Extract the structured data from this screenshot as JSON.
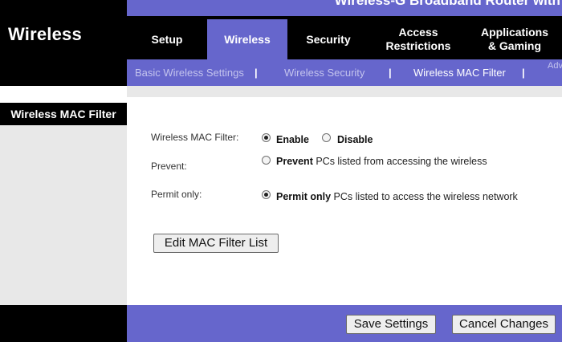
{
  "header": {
    "product_name": "Wireless-G Broadband Router with S",
    "section_title": "Wireless"
  },
  "main_nav": {
    "tabs": [
      {
        "label": "Setup"
      },
      {
        "label": "Wireless",
        "active": true
      },
      {
        "label": "Security"
      },
      {
        "label": "Access\nRestrictions"
      },
      {
        "label": "Applications\n& Gaming"
      }
    ]
  },
  "sub_nav": {
    "items": [
      {
        "label": "Basic Wireless Settings"
      },
      {
        "label": "Wireless Security"
      },
      {
        "label": "Wireless MAC Filter",
        "active": true
      },
      {
        "label": "Adv"
      }
    ],
    "separator": "|"
  },
  "sidebar": {
    "subheading": "Wireless MAC Filter"
  },
  "form": {
    "mac_filter": {
      "label": "Wireless MAC Filter:",
      "enable_label": "Enable",
      "disable_label": "Disable",
      "selected": "Enable"
    },
    "prevent": {
      "label": "Prevent:",
      "option_bold": "Prevent",
      "option_rest": " PCs listed from accessing the wireless",
      "selected": false
    },
    "permit": {
      "label": "Permit only:",
      "option_bold": "Permit only",
      "option_rest": " PCs listed to access the wireless network",
      "selected": true
    },
    "edit_button_label": "Edit MAC Filter List"
  },
  "footer": {
    "save_label": "Save Settings",
    "cancel_label": "Cancel Changes"
  },
  "colors": {
    "accent": "#6666cc",
    "dark": "#000000",
    "panel_gray": "#e8e8e8"
  }
}
